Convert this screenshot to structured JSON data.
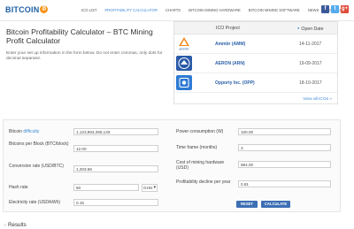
{
  "header": {
    "logo_text": "BITCOIN",
    "logo_badge": "₿",
    "nav": [
      {
        "label": "ICO LIST",
        "active": false
      },
      {
        "label": "PROFITABILITY CALCULATOR",
        "active": true
      },
      {
        "label": "CHARTS",
        "active": false
      },
      {
        "label": "BITCOIN MINING HARDWARE",
        "active": false
      },
      {
        "label": "BITCOIN MINING SOFTWARE",
        "active": false
      },
      {
        "label": "NEWS",
        "active": false
      },
      {
        "label": "CONTACT",
        "active": false
      }
    ],
    "social": [
      {
        "icon": "facebook-icon",
        "glyph": "f"
      },
      {
        "icon": "twitter-icon",
        "glyph": "t"
      },
      {
        "icon": "google-plus-icon",
        "glyph": "g+"
      }
    ]
  },
  "page": {
    "title": "Bitcoin Profitability Calculator – BTC Mining Profit Calculator",
    "intro": "Enter your set up information in the form below. Do not enter commas, only dots for decimal separator."
  },
  "ico_table": {
    "col_project": "ICO Project",
    "col_date": "Open Date",
    "rows": [
      {
        "name": "Ammbr (AMM)",
        "date": "14-11-2017",
        "logo_color": "#ffffff",
        "logo_caption": "ammbr"
      },
      {
        "name": "AERON (ARN)",
        "date": "19-09-2017",
        "logo_color": "#2a5aa8",
        "logo_caption": ""
      },
      {
        "name": "Opporty Inc. (OPP)",
        "date": "18-10-2017",
        "logo_color": "#2f7bd4",
        "logo_caption": ""
      }
    ],
    "view_all": "View all ICOs »"
  },
  "form": {
    "difficulty_label_prefix": "Bitcoin ",
    "difficulty_label_link": "difficulty",
    "difficulty_value": "1,123,863,285,133",
    "btc_per_block_label": "Bitcoins per Block (BTC/block)",
    "btc_per_block_value": "12.00",
    "conversion_label": "Conversion rate (USD/BTC)",
    "conversion_value": "1,203.66",
    "hash_rate_label": "Hash rate",
    "hash_rate_value": "50",
    "hash_rate_unit": "GH/s",
    "electricity_label": "Electricity rate (USD/kWh)",
    "electricity_value": "0.15",
    "power_label": "Power consumption (W)",
    "power_value": "100.00",
    "time_frame_label": "Time frame (months)",
    "time_frame_value": "3",
    "hardware_cost_label": "Cost of mining hardware (USD)",
    "hardware_cost_value": "984.00",
    "decline_label": "Profitability decline per year",
    "decline_value": "0.81",
    "reset_label": "RESET",
    "calculate_label": "CALCULATE"
  },
  "results": {
    "heading": "Results"
  }
}
